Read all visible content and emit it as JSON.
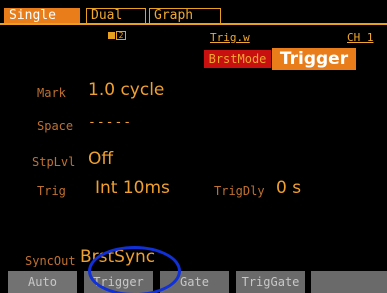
{
  "tabs": {
    "single": "Single",
    "dual": "Dual",
    "graph": "Graph"
  },
  "status": {
    "memory_number": "2",
    "trigger_waveform": "Trig.w",
    "channel": "CH 1",
    "brst_mode_label": "BrstMode",
    "mode_value": "Trigger"
  },
  "params": {
    "mark": {
      "label": "Mark",
      "value": "1.0 cycle"
    },
    "space": {
      "label": "Space",
      "value": "-----"
    },
    "stop_level": {
      "label": "StpLvl",
      "value": "Off"
    },
    "trig": {
      "label": "Trig",
      "value": "Int 10ms"
    },
    "trig_delay": {
      "label": "TrigDly",
      "value": "0 s"
    },
    "sync_out": {
      "label": "SyncOut",
      "value": "BrstSync"
    }
  },
  "softkeys": [
    "Auto",
    "Trigger",
    "Gate",
    "TrigGate",
    ""
  ],
  "colors": {
    "accent": "#e87d1a",
    "text": "#f0a030",
    "label": "#c07030",
    "brst_mode_bg": "#c81010",
    "softkey_bg": "#6a6a6a",
    "highlight": "#1030d8"
  }
}
